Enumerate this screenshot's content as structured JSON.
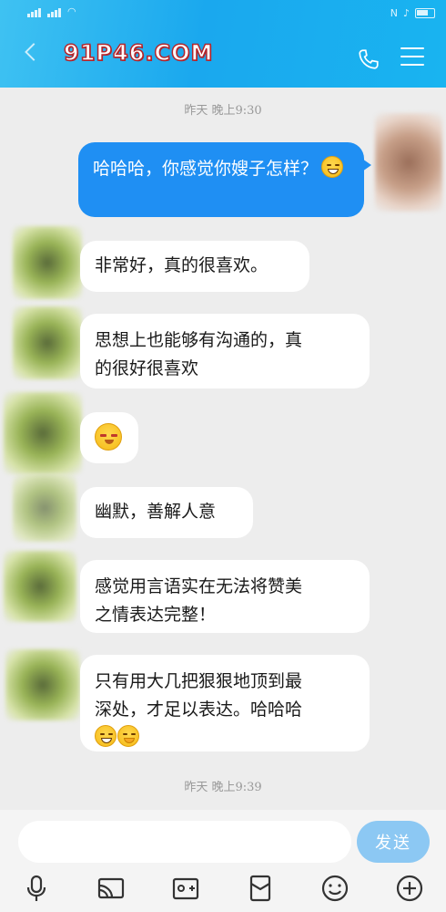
{
  "header": {
    "watermark": "91P46.COM",
    "colors": {
      "bar": "#1aa8ee",
      "bubble_out": "#1f8ff3",
      "bubble_in": "#ffffff",
      "send": "#8cc8f3"
    },
    "icons": {
      "back": "back-icon",
      "call": "phone-icon",
      "menu": "menu-icon"
    }
  },
  "chat": {
    "timestamp_1": "昨天 晚上9:30",
    "timestamp_2": "昨天 晚上9:39",
    "messages": [
      {
        "side": "right",
        "text": "哈哈哈，你感觉你嫂子怎样？",
        "emoji": "grinning-face-icon"
      },
      {
        "side": "left",
        "text": "非常好，真的很喜欢。"
      },
      {
        "side": "left",
        "line1": "思想上也能够有沟通的，真",
        "line2": "的很好很喜欢"
      },
      {
        "side": "left",
        "emoji": "blushing-face-icon"
      },
      {
        "side": "left",
        "text": "幽默，善解人意"
      },
      {
        "side": "left",
        "line1": "感觉用言语实在无法将赞美",
        "line2": "之情表达完整！"
      },
      {
        "side": "left",
        "line1": "只有用大几把狠狠地顶到最",
        "line2": "深处，才足以表达。哈哈哈",
        "emoji": [
          "grinning-face-icon",
          "hand-over-mouth-face-icon"
        ]
      }
    ]
  },
  "composer": {
    "input_value": "",
    "send_label": "发送",
    "tools": [
      "microphone-icon",
      "cast-screen-icon",
      "add-photo-icon",
      "red-envelope-icon",
      "emoji-face-icon",
      "plus-circle-icon"
    ]
  }
}
